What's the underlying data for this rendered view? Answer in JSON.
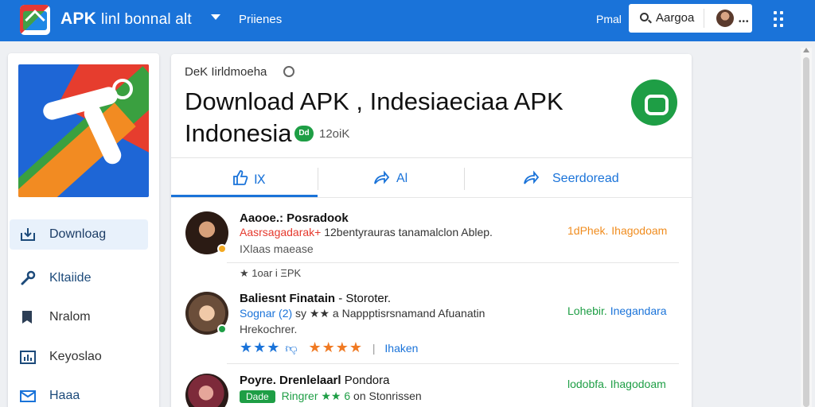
{
  "topbar": {
    "app_title_bold": "APK",
    "app_title_rest": "linl bonnal alt",
    "nav_link": "Priienes",
    "right_link": "Pmal",
    "search_value": "Aargoa",
    "search_more": "•••"
  },
  "sidebar": {
    "items": [
      {
        "label": "Downlоag",
        "icon": "download-icon",
        "active": true
      },
      {
        "label": "Kltaiide",
        "icon": "wrench-icon",
        "active": false
      },
      {
        "label": "Nralom",
        "icon": "bookmark-icon",
        "active": false
      },
      {
        "label": "Keyoslao",
        "icon": "chart-icon",
        "active": false
      },
      {
        "label": "Haaa",
        "icon": "mail-icon",
        "active": false
      }
    ]
  },
  "main": {
    "breadcrumb": "DeK  Iirldmoeha",
    "title": "Download APK , Indesiaeciaa APK Indonesia",
    "badge": "Dd",
    "download_count": "12oiK",
    "tabs": [
      {
        "label": "Ⅸ",
        "icon": "thumbs-up-icon"
      },
      {
        "label": "Al",
        "icon": "share-icon"
      },
      {
        "label": "Seerdoread",
        "icon": "forward-icon"
      }
    ],
    "reviews": [
      {
        "name": "Aaooe.: Posradook",
        "line1_red": "Aasrsagadarak+",
        "line1_rest": "12bentyrauras tanamalclon Ablep.",
        "line2": "IXlaas maease",
        "line3": "★ 1oar   i ΞPK",
        "right_a": "1dPhek.",
        "right_b": "Ihagodoam"
      },
      {
        "name": "Baliesnt Finatain",
        "name_suffix": "- Storoter.",
        "line1_blue": "Sognar (2)",
        "line1_rest": "sy ★★ a Nappptisrsnamand Afuanatin",
        "line2": "Hrekochrer.",
        "stars_blue": "★★★",
        "stars_orange": "★★★★",
        "link": "Ihaken",
        "right_a": "Lohebir.",
        "right_b": "Inegandara"
      },
      {
        "name": "Poyre. Drenlelaarl",
        "name_suffix": "Pondora",
        "pill": "Dade",
        "line1_green": "Ringrer ★★ 6",
        "line1_rest": "on Stonrissen",
        "right_a": "lodobfa.",
        "right_b": "Ihagodoam"
      }
    ]
  },
  "colors": {
    "brand": "#1a73d9",
    "green": "#1e9e45",
    "red": "#e5392d",
    "orange": "#f08c1e"
  }
}
